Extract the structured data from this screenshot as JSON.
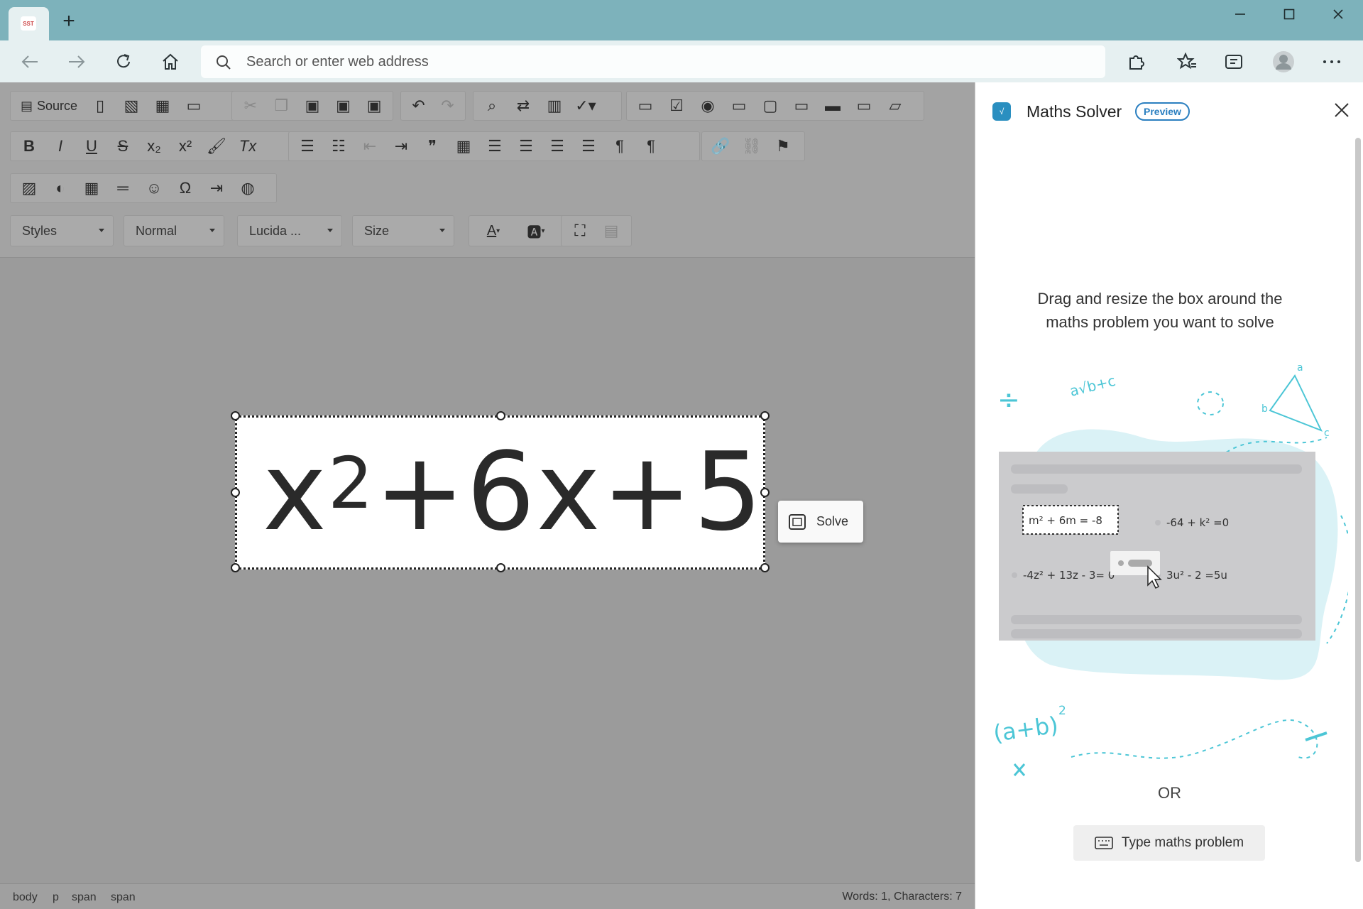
{
  "browser": {
    "tab_favicon_text": "SST",
    "new_tab_symbol": "+",
    "address_placeholder": "Search or enter web address"
  },
  "toolbar": {
    "source_label": "Source",
    "styles_label": "Styles",
    "format_label": "Normal",
    "font_label": "Lucida ...",
    "size_label": "Size"
  },
  "content": {
    "expr_base": "x",
    "expr_exp": "2",
    "expr_rest": "+6x+5"
  },
  "solve_label": "Solve",
  "statusbar": {
    "path": [
      "body",
      "p",
      "span",
      "span"
    ],
    "counts": "Words: 1, Characters: 7"
  },
  "panel": {
    "title": "Maths Solver",
    "badge": "Preview",
    "instructions": "Drag and resize the box around the maths problem you want to solve",
    "or_label": "OR",
    "type_button": "Type maths problem",
    "illustration": {
      "eq1": "m² + 6m = -8",
      "eq2": "-64 + k² =0",
      "eq3": "-4z² + 13z - 3= 0",
      "eq4": "3u² - 2  =5u",
      "formula1": "(a+b)",
      "formula1_exp": "2",
      "formula2": "a√b+c",
      "tri_a": "a",
      "tri_b": "b",
      "tri_c": "c"
    }
  },
  "colors": {
    "title_bar": "#7db2bb",
    "accent": "#2a7fc0",
    "illustration": "#4cc6d6"
  }
}
